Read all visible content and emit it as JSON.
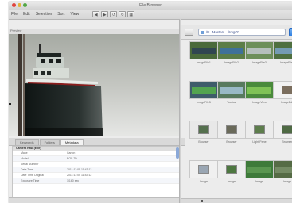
{
  "window": {
    "title": "File Browser"
  },
  "colors": {
    "accent": "#2f7fe0",
    "light_red": "#e0443e",
    "light_yellow": "#e2b33a",
    "light_green": "#53a745"
  },
  "menu": {
    "items": [
      "File",
      "Edit",
      "Selection",
      "Sort",
      "View"
    ]
  },
  "toolbar": {
    "tools": [
      {
        "name": "back-icon",
        "glyph": "◀"
      },
      {
        "name": "forward-icon",
        "glyph": "▶"
      },
      {
        "name": "rotate-left-icon",
        "glyph": "↺"
      },
      {
        "name": "rotate-right-icon",
        "glyph": "↻"
      },
      {
        "name": "view-icon",
        "glyph": "▦"
      }
    ]
  },
  "preview": {
    "label": "Preview"
  },
  "tabs": [
    {
      "label": "Keywords"
    },
    {
      "label": "Folders"
    },
    {
      "label": "Metadata"
    }
  ],
  "properties": {
    "group_label": "Camera Raw (Exif)",
    "rows": [
      {
        "key": "Make",
        "value": "Canon"
      },
      {
        "key": "Model",
        "value": "EOS 7D"
      },
      {
        "key": "Serial Number",
        "value": ""
      },
      {
        "key": "Date Time",
        "value": "2011:11:05 11:43:12"
      },
      {
        "key": "Date Time Original",
        "value": "2011:11:05 11:43:12"
      },
      {
        "key": "Exposure Time",
        "value": "1/160 sec"
      }
    ]
  },
  "path": {
    "text": "/U...Masters..../Img/02"
  },
  "thumbnails": [
    {
      "label": "ImageFile1",
      "bg": "#4a6a3a",
      "inner": "#2b3f55",
      "landscape": true
    },
    {
      "label": "ImageFile2",
      "bg": "#5c7d48",
      "inner": "#3a6fa8",
      "landscape": true
    },
    {
      "label": "ImageFile3",
      "bg": "#6d8f5a",
      "inner": "#c2c8ce",
      "landscape": true
    },
    {
      "label": "ImageFile4",
      "bg": "#4f7040",
      "inner": "#7aa2c8",
      "landscape": true
    },
    {
      "label": "ImageFile5",
      "bg": "#3e5c6a",
      "inner": "#57b04a",
      "landscape": true
    },
    {
      "label": "Toolbar",
      "bg": "#587a5e",
      "inner": "#a4c4d8",
      "landscape": true
    },
    {
      "label": "ImageView",
      "bg": "#4a8a3c",
      "inner": "#8acb5a",
      "landscape": true
    },
    {
      "label": "ImageEdit",
      "bg": "#f2f2f2",
      "inner": "#7b6e5e",
      "landscape": false
    },
    {
      "label": "Browser",
      "bg": "#e8e8e8",
      "inner": "#55704e",
      "landscape": false
    },
    {
      "label": "Browser",
      "bg": "#ececec",
      "inner": "#6a6a5a",
      "landscape": false
    },
    {
      "label": "Light Pane",
      "bg": "#ececec",
      "inner": "#5d7d4c",
      "landscape": false
    },
    {
      "label": "Browser",
      "bg": "#efefef",
      "inner": "#4f6a44",
      "landscape": false
    },
    {
      "label": "Image",
      "bg": "#f0f0f0",
      "inner": "#9aa6b3",
      "landscape": false
    },
    {
      "label": "Image",
      "bg": "#eeeeee",
      "inner": "#4d7740",
      "landscape": false
    },
    {
      "label": "Image",
      "bg": "#3e7a3a",
      "inner": "#5f9b55",
      "landscape": true
    },
    {
      "label": "Image",
      "bg": "#556b45",
      "inner": "#7a8f6a",
      "landscape": true
    }
  ]
}
